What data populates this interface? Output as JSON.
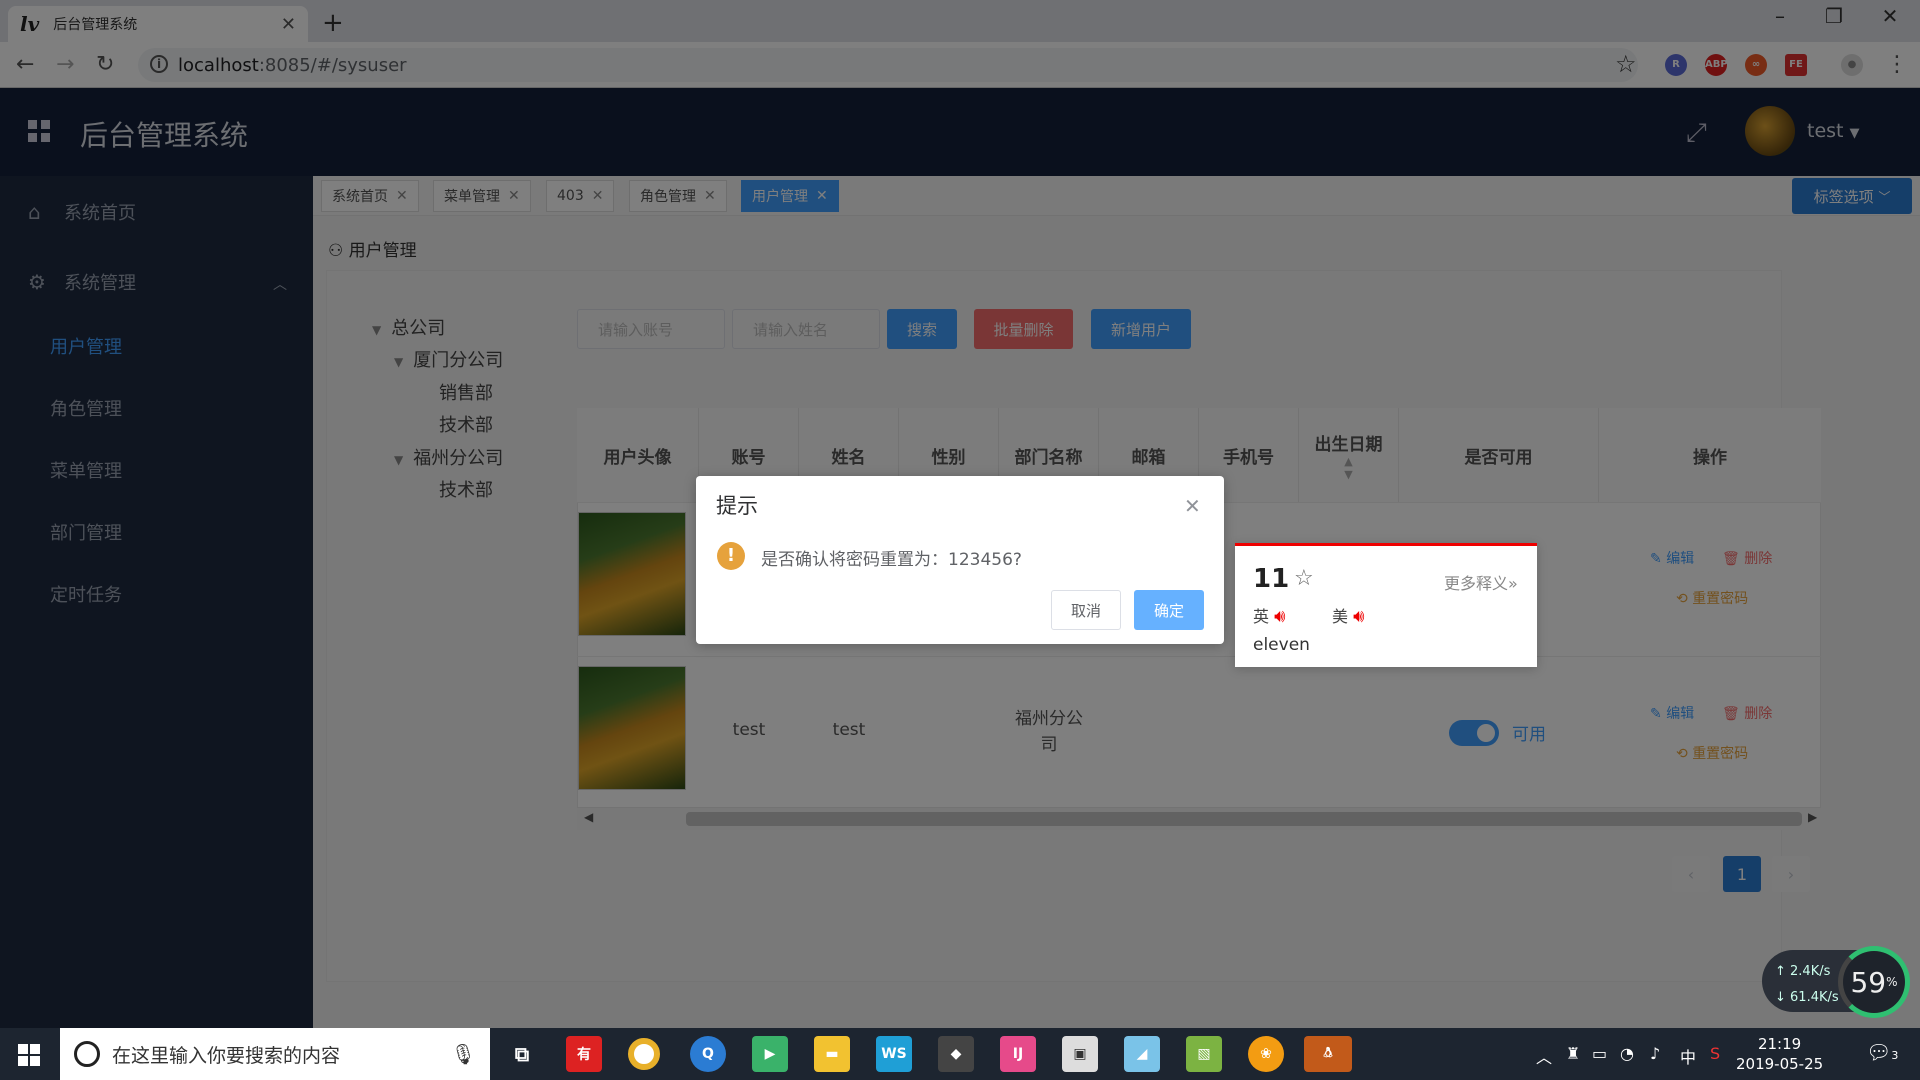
{
  "browser": {
    "tab_title": "后台管理系统",
    "favicon": "lv",
    "url_host": "localhost",
    "url_rest": ":8085/#/sysuser"
  },
  "header": {
    "title": "后台管理系统",
    "username": "test"
  },
  "sidebar": {
    "items": [
      {
        "label": "系统首页",
        "icon": "home-icon"
      },
      {
        "label": "系统管理",
        "icon": "gear-icon"
      }
    ],
    "subitems": [
      "用户管理",
      "角色管理",
      "菜单管理",
      "部门管理",
      "定时任务"
    ]
  },
  "tags": {
    "items": [
      "系统首页",
      "菜单管理",
      "403",
      "角色管理",
      "用户管理"
    ],
    "options_label": "标签选项"
  },
  "breadcrumb": "用户管理",
  "tree": {
    "root": "总公司",
    "xiamen": "厦门分公司",
    "xiamen_children": [
      "销售部",
      "技术部"
    ],
    "fuzhou": "福州分公司",
    "fuzhou_children": [
      "技术部"
    ]
  },
  "search": {
    "account_placeholder": "请输入账号",
    "name_placeholder": "请输入姓名",
    "search_label": "搜索",
    "batch_delete_label": "批量删除",
    "add_user_label": "新增用户"
  },
  "table": {
    "headers": [
      "用户头像",
      "账号",
      "姓名",
      "性别",
      "部门名称",
      "邮箱",
      "手机号",
      "出生日期",
      "是否可用",
      "操作"
    ],
    "rows": [
      {
        "account": "test",
        "name": "test",
        "dept": "福州分公司",
        "enabled": "可用"
      }
    ],
    "edit_label": "编辑",
    "delete_label": "删除",
    "reset_label": "重置密码"
  },
  "pagination": {
    "current": "1"
  },
  "dialog": {
    "title": "提示",
    "message": "是否确认将密码重置为：123456?",
    "cancel": "取消",
    "confirm": "确定"
  },
  "dict_popup": {
    "word": "11",
    "more": "更多释义»",
    "uk": "英",
    "us": "美",
    "definition": "eleven"
  },
  "speed": {
    "up": "2.4K/s",
    "down": "61.4K/s",
    "percent": "59"
  },
  "taskbar": {
    "search_placeholder": "在这里输入你要搜索的内容",
    "time": "21:19",
    "date": "2019-05-25",
    "ime": "中",
    "notifications": "3"
  }
}
